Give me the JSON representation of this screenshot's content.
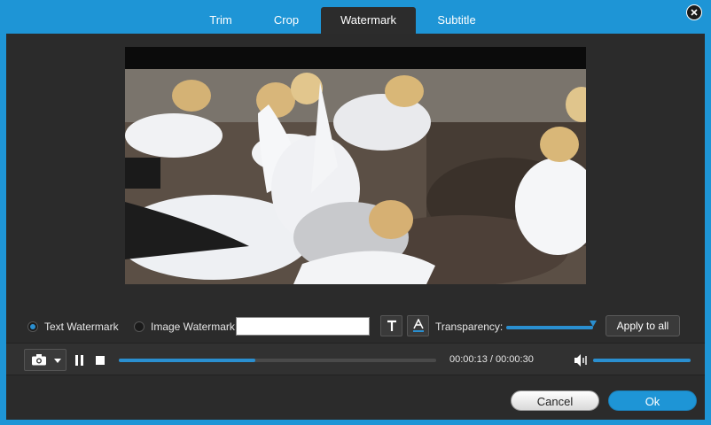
{
  "tabs": [
    {
      "label": "Trim"
    },
    {
      "label": "Crop"
    },
    {
      "label": "Watermark",
      "active": true
    },
    {
      "label": "Subtitle"
    }
  ],
  "watermark": {
    "text_option": "Text Watermark",
    "image_option": "Image Watermark",
    "selected": "Text Watermark",
    "text_value": "",
    "transparency_label": "Transparency:",
    "transparency_level": 1.0,
    "apply_label": "Apply to all"
  },
  "playback": {
    "current_time": "00:00:13",
    "total_time": "00:00:30",
    "time_display": "00:00:13 / 00:00:30",
    "progress": 0.43,
    "volume": 1.0
  },
  "footer": {
    "cancel_label": "Cancel",
    "ok_label": "Ok"
  },
  "colors": {
    "accent": "#1e95d6",
    "panel": "#2b2b2b"
  },
  "icons": [
    "close-icon",
    "camera-icon",
    "pause-icon",
    "stop-icon",
    "volume-icon",
    "text-style-icon",
    "text-color-icon"
  ]
}
